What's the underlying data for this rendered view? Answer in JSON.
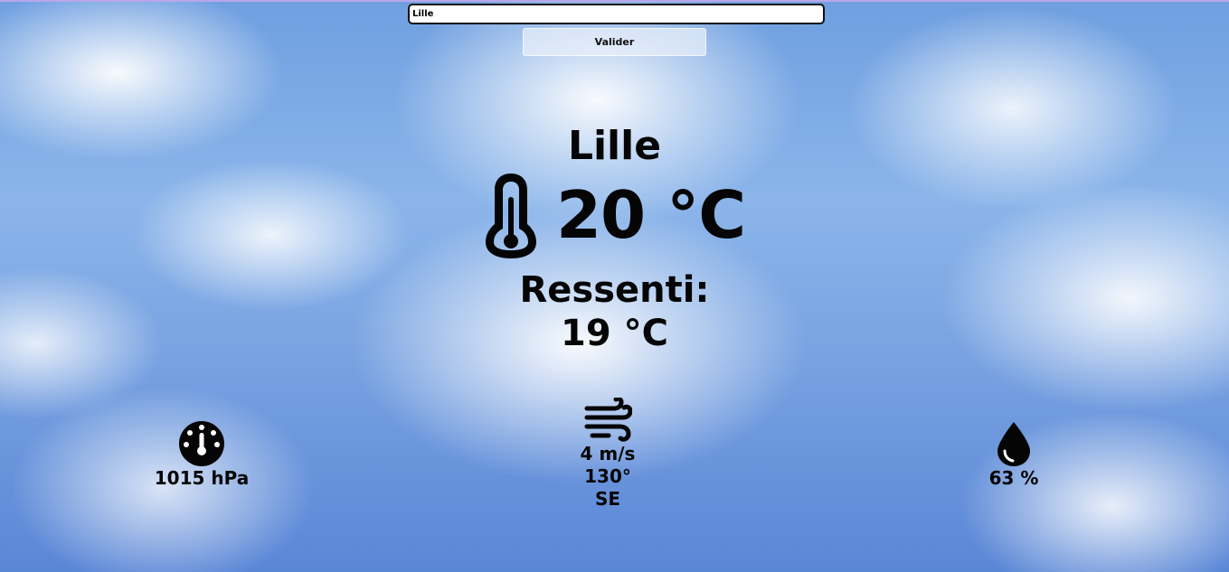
{
  "search": {
    "value": "Lille"
  },
  "form": {
    "submit_label": "Valider"
  },
  "weather": {
    "city": "Lille",
    "temperature": "20 °C",
    "feels_like_label": "Ressenti:",
    "feels_like_value": "19 °C",
    "pressure": "1015 hPa",
    "wind_speed": "4 m/s",
    "wind_degrees": "130°",
    "wind_direction": "SE",
    "humidity": "63 %"
  },
  "icons": {
    "temperature": "thermometer-icon",
    "pressure": "gauge-icon",
    "wind": "wind-icon",
    "humidity": "droplet-icon"
  },
  "colors": {
    "text": "#050505",
    "sky": "#7aa4e2",
    "input_border": "#111111"
  }
}
